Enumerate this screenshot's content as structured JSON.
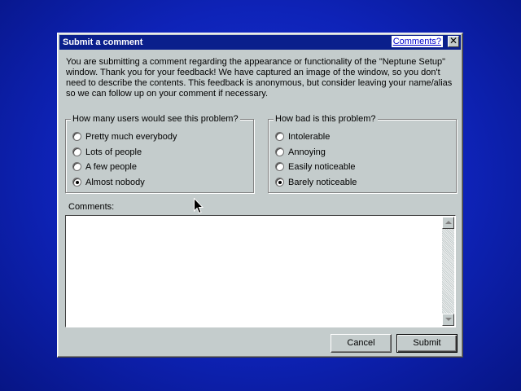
{
  "dialog": {
    "title": "Submit a comment",
    "comments_link": "Comments?",
    "close_glyph": "✕",
    "description": "You are submitting a comment regarding the appearance or functionality of the \"Neptune Setup\" window. Thank you for your feedback! We have captured an image of the window, so you don't need to describe the contents. This feedback is anonymous, but consider leaving your name/alias so we can follow up on your comment if necessary."
  },
  "users_group": {
    "legend": "How many users would see this problem?",
    "options": [
      "Pretty much everybody",
      "Lots of people",
      "A few people",
      "Almost nobody"
    ],
    "selected": "Almost nobody"
  },
  "severity_group": {
    "legend": "How bad is this problem?",
    "options": [
      "Intolerable",
      "Annoying",
      "Easily noticeable",
      "Barely noticeable"
    ],
    "selected": "Barely noticeable"
  },
  "comments": {
    "label": "Comments:",
    "value": ""
  },
  "buttons": {
    "cancel": "Cancel",
    "submit": "Submit"
  },
  "colors": {
    "desktop": "#0e23b8",
    "titlebar": "#0a1f8c",
    "dialog_face": "#c4cccc",
    "link": "#0000cc"
  },
  "icons": [
    "close-icon",
    "scroll-up-arrow-icon",
    "scroll-down-arrow-icon",
    "mouse-cursor-icon"
  ]
}
